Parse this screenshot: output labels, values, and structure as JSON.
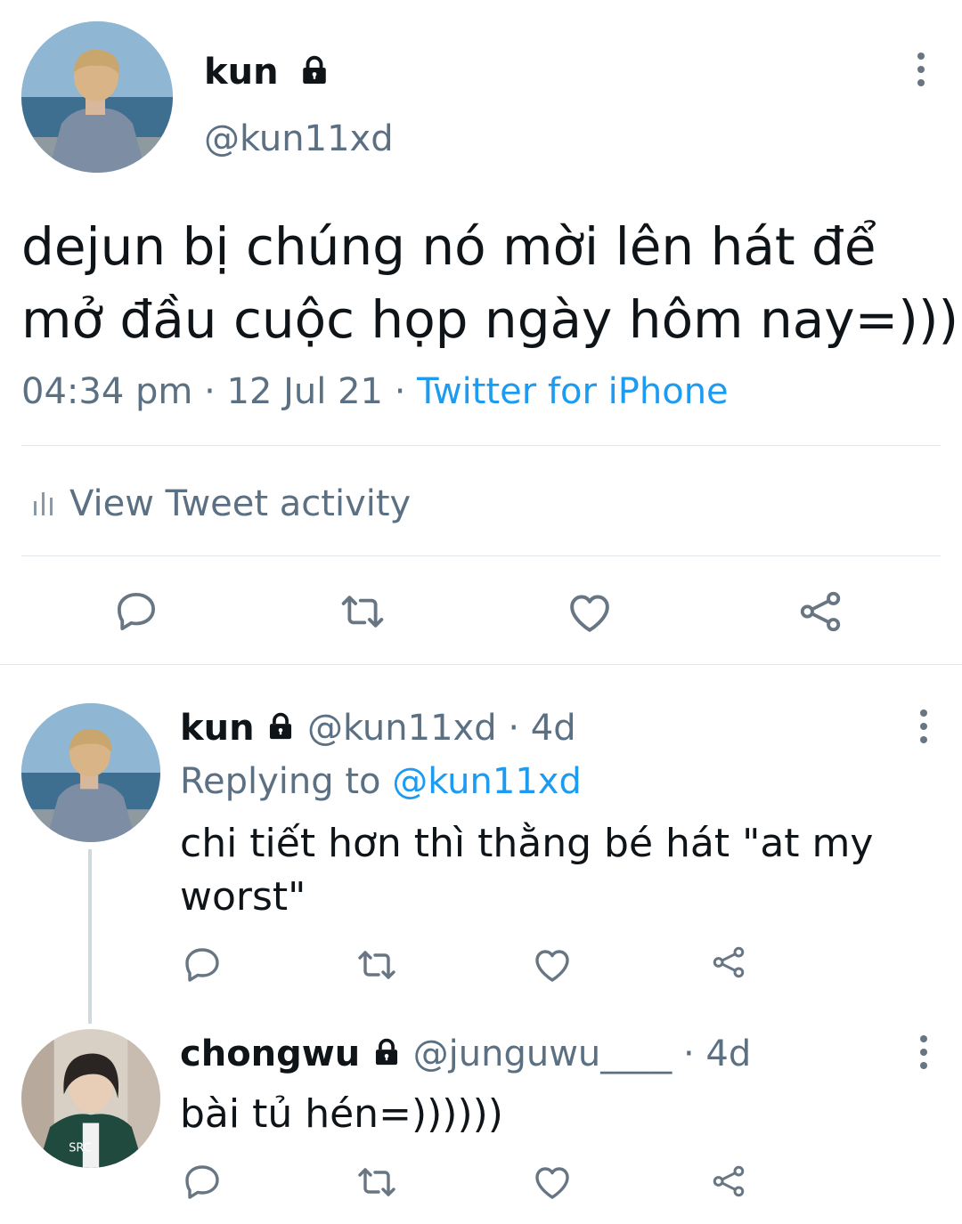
{
  "main_tweet": {
    "display_name": "kun",
    "handle": "@kun11xd",
    "text_line1": "dejun bị chúng nó mời lên hát để",
    "text_line2": "mở đầu cuộc họp ngày hôm nay=)))",
    "time": "04:34 pm",
    "date": "12 Jul 21",
    "dot": "·",
    "source": "Twitter for iPhone",
    "activity_label": "View Tweet activity"
  },
  "replies": [
    {
      "display_name": "kun",
      "handle": "@kun11xd",
      "age": "· 4d",
      "replying_prefix": "Replying to",
      "replying_handle": "@kun11xd",
      "text_line1": "chi tiết hơn thì thằng bé hát \"at my",
      "text_line2": "worst\""
    },
    {
      "display_name": "chongwu",
      "handle": "@junguwu____",
      "age": "· 4d",
      "text_line1": "bài tủ hén=))))))"
    }
  ],
  "colors": {
    "accent": "#1d9bf0",
    "secondary_text": "#5b7083",
    "icon": "#687684",
    "separator": "#e1e6ea"
  },
  "icons": [
    "lock-icon",
    "more-icon",
    "reply-icon",
    "retweet-icon",
    "like-icon",
    "share-icon",
    "activity-icon"
  ]
}
